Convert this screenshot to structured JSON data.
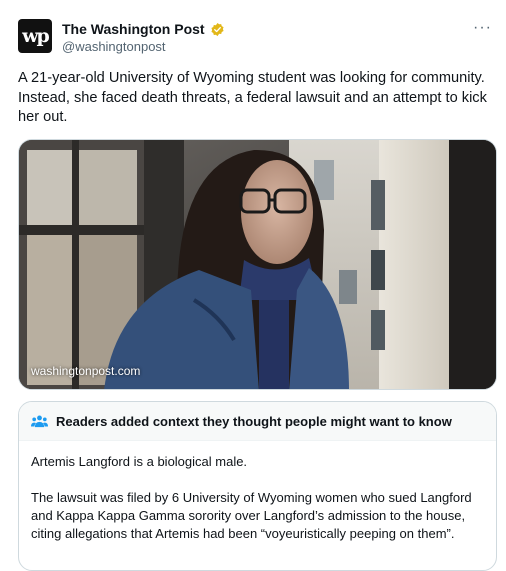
{
  "tweet": {
    "author_name": "The Washington Post",
    "author_handle": "@washingtonpost",
    "avatar_text": "wp",
    "more_label": "···",
    "text": "A 21-year-old University of Wyoming student was looking for community. Instead, she faced death threats, a federal lawsuit and an attempt to kick her out.",
    "media": {
      "domain": "washingtonpost.com"
    }
  },
  "community_note": {
    "header": "Readers added context they thought people might want to know",
    "paragraphs": [
      "Artemis Langford is a biological male.",
      "The lawsuit was filed by 6 University of Wyoming women who sued Langford and Kappa Kappa Gamma sorority over Langford’s admission to the house, citing allegations that Artemis had been “voyeuristically peeping on them”."
    ]
  },
  "colors": {
    "verified_badge": "#e2b719",
    "note_icon": "#1d9bf0",
    "secondary_text": "#536471"
  },
  "icons": {
    "verified": "verified-badge-icon",
    "note": "people-icon",
    "more": "ellipsis-icon"
  }
}
